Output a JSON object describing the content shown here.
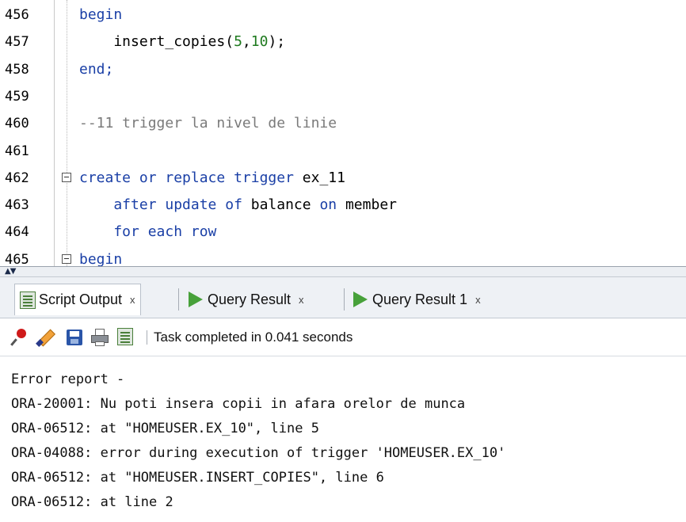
{
  "editor": {
    "lines": [
      {
        "n": "456",
        "parts": [
          {
            "t": "begin",
            "c": "kw"
          }
        ],
        "fold": false
      },
      {
        "n": "457",
        "parts": [
          {
            "t": "    insert_copies(",
            "c": ""
          },
          {
            "t": "5",
            "c": "num"
          },
          {
            "t": ",",
            "c": ""
          },
          {
            "t": "10",
            "c": "num"
          },
          {
            "t": ");",
            "c": ""
          }
        ],
        "fold": false
      },
      {
        "n": "458",
        "parts": [
          {
            "t": "end;",
            "c": "kw"
          }
        ],
        "fold": false
      },
      {
        "n": "459",
        "parts": [],
        "fold": false
      },
      {
        "n": "460",
        "parts": [
          {
            "t": "--11 trigger la nivel de linie",
            "c": "cmt"
          }
        ],
        "fold": false
      },
      {
        "n": "461",
        "parts": [],
        "fold": false
      },
      {
        "n": "462",
        "parts": [
          {
            "t": "create or replace trigger ",
            "c": "kw"
          },
          {
            "t": "ex_11",
            "c": ""
          }
        ],
        "fold": true
      },
      {
        "n": "463",
        "parts": [
          {
            "t": "    after update of ",
            "c": "kw"
          },
          {
            "t": "balance",
            "c": ""
          },
          {
            "t": " on ",
            "c": "kw"
          },
          {
            "t": "member",
            "c": ""
          }
        ],
        "fold": false
      },
      {
        "n": "464",
        "parts": [
          {
            "t": "    for each row",
            "c": "kw"
          }
        ],
        "fold": false
      },
      {
        "n": "465",
        "parts": [
          {
            "t": "begin",
            "c": "kw"
          }
        ],
        "fold": true
      }
    ]
  },
  "tabs": [
    {
      "label": "Script Output",
      "close": "x",
      "icon": "script-output-icon",
      "active": true
    },
    {
      "label": "Query Result",
      "close": "x",
      "icon": "run-icon",
      "active": false
    },
    {
      "label": "Query Result 1",
      "close": "x",
      "icon": "run-icon",
      "active": false
    }
  ],
  "toolbar": {
    "icons": [
      "pin-icon",
      "eraser-icon",
      "save-icon",
      "print-icon",
      "script-output-icon"
    ],
    "status": "Task completed in 0.041 seconds"
  },
  "output": {
    "lines": [
      "Error report -",
      "ORA-20001: Nu poti insera copii in afara orelor de munca",
      "ORA-06512: at \"HOMEUSER.EX_10\", line 5",
      "ORA-04088: error during execution of trigger 'HOMEUSER.EX_10'",
      "ORA-06512: at \"HOMEUSER.INSERT_COPIES\", line 6",
      "ORA-06512: at line 2"
    ]
  },
  "colors": {
    "keyword": "#1a3fa6",
    "number": "#1f7a1f",
    "comment": "#7a7a7a",
    "run_icon": "#47a13a"
  }
}
